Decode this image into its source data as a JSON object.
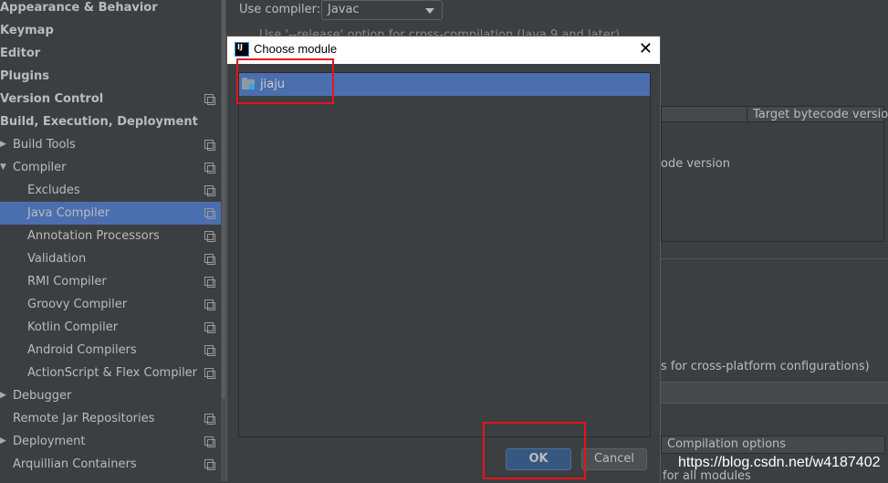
{
  "sidebar": {
    "items": [
      {
        "label": "Appearance & Behavior"
      },
      {
        "label": "Keymap"
      },
      {
        "label": "Editor"
      },
      {
        "label": "Plugins"
      },
      {
        "label": "Version Control"
      },
      {
        "label": "Build, Execution, Deployment"
      },
      {
        "label": "Build Tools"
      },
      {
        "label": "Compiler"
      },
      {
        "label": "Excludes"
      },
      {
        "label": "Java Compiler"
      },
      {
        "label": "Annotation Processors"
      },
      {
        "label": "Validation"
      },
      {
        "label": "RMI Compiler"
      },
      {
        "label": "Groovy Compiler"
      },
      {
        "label": "Kotlin Compiler"
      },
      {
        "label": "Android Compilers"
      },
      {
        "label": "ActionScript & Flex Compiler"
      },
      {
        "label": "Debugger"
      },
      {
        "label": "Remote Jar Repositories"
      },
      {
        "label": "Deployment"
      },
      {
        "label": "Arquillian Containers"
      }
    ],
    "selected": "Java Compiler"
  },
  "main": {
    "use_compiler_label": "Use compiler:",
    "compiler_value": "Javac",
    "release_option_label": "Use '--release' option for cross-compilation (Java 9 and later)",
    "target_bytecode_header": "Target bytecode version",
    "bytecode_fragment": "ode version",
    "cross_platform_fragment": "s for cross-platform configurations)",
    "compilation_options_header": "Compilation options",
    "all_modules_fragment": "for all modules"
  },
  "dialog": {
    "title": "Choose module",
    "logo_text": "IJ",
    "modules": [
      {
        "label": "jiaju",
        "selected": true
      }
    ],
    "ok_label": "OK",
    "cancel_label": "Cancel"
  },
  "watermark": "https://blog.csdn.net/w4187402",
  "colors": {
    "selection": "#4b6eaf",
    "background": "#3c3f41",
    "annotation": "#e8121c"
  }
}
